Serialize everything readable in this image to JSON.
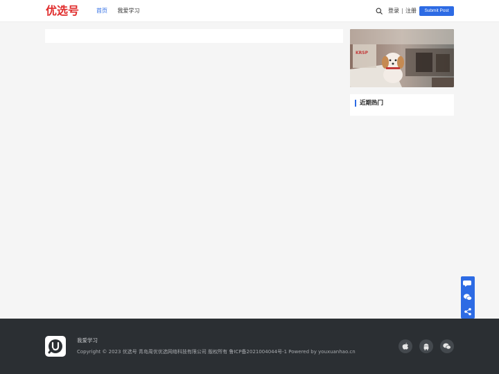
{
  "header": {
    "logo_text": "优选号",
    "nav": [
      "首页",
      "我爱学习"
    ],
    "login": "登录",
    "register": "注册",
    "submit_label": "Submit Post"
  },
  "sidebar": {
    "hot_title": "近期热门"
  },
  "footer": {
    "title": "我爱学习",
    "copyright": "Copyright ©  2023 优选号 青岛周优优选网络科技有限公司 版权所有 鲁ICP备2021004044号-1 Powered by youxuanhao.cn"
  },
  "colors": {
    "accent": "#2d6be4",
    "logo": "#e02b2b",
    "footer_bg": "#2b2f33"
  },
  "icons": {
    "search": "search-icon",
    "float": [
      "chat-icon",
      "wechat-icon",
      "share-icon"
    ],
    "footer": [
      "apple-icon",
      "android-icon",
      "wechat-icon"
    ]
  }
}
